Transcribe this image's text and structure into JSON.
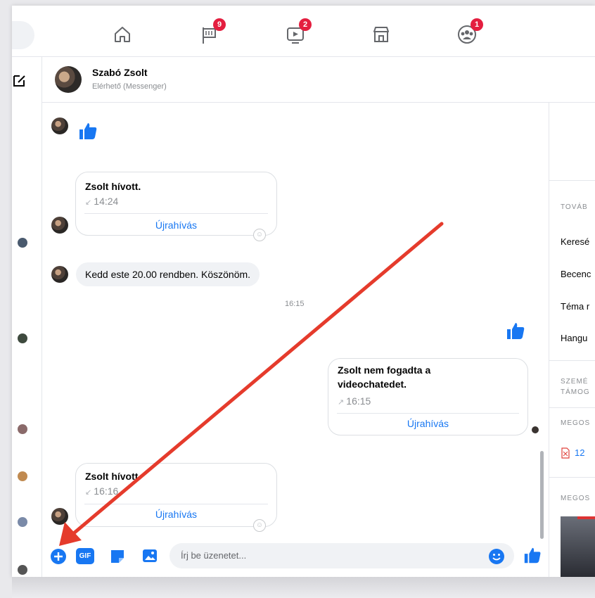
{
  "nav": {
    "badges": {
      "pages": "9",
      "watch": "2",
      "groups": "1"
    }
  },
  "chat": {
    "name": "Szabó Zsolt",
    "status": "Elérhető (Messenger)"
  },
  "messages": {
    "call1": {
      "title": "Zsolt hívott.",
      "time": "14:24",
      "action": "Újrahívás"
    },
    "text1": "Kedd este 20.00 rendben. Köszönöm.",
    "timestamp": "16:15",
    "missed": {
      "title_line1": "Zsolt nem fogadta a",
      "title_line2": "videochatedet.",
      "time": "16:15",
      "action": "Újrahívás"
    },
    "call2": {
      "title": "Zsolt hívott.",
      "time": "16:16",
      "action": "Újrahívás"
    }
  },
  "right_panel": {
    "section1": "TOVÁB",
    "items": [
      "Keresé",
      "Becenc",
      "Téma r",
      "Hangu"
    ],
    "section2_line1": "SZEMÉ",
    "section2_line2": "TÁMOG",
    "section3": "MEGOS",
    "file_label": "12",
    "section4": "MEGOS"
  },
  "composer": {
    "placeholder": "Írj be üzenetet...",
    "gif_label": "GIF"
  },
  "colors": {
    "accent": "#1877f2",
    "badge": "#e41e3f",
    "arrow": "#e53b2c"
  }
}
